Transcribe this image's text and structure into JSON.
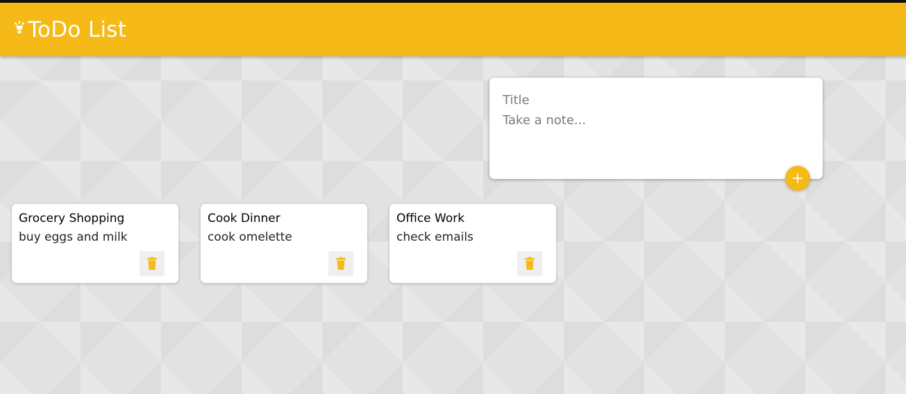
{
  "header": {
    "title": "ToDo List",
    "logo_icon": "lightbulb-icon"
  },
  "create_note": {
    "title_placeholder": "Title",
    "content_placeholder": "Take a note...",
    "add_icon": "plus-icon"
  },
  "notes": [
    {
      "title": "Grocery Shopping",
      "content": "buy eggs and milk",
      "delete_icon": "trash-icon"
    },
    {
      "title": "Cook Dinner",
      "content": "cook omelette",
      "delete_icon": "trash-icon"
    },
    {
      "title": "Office Work",
      "content": "check emails",
      "delete_icon": "trash-icon"
    }
  ],
  "colors": {
    "accent": "#f5ba18",
    "background": "#e2e2e2",
    "card": "#ffffff"
  }
}
